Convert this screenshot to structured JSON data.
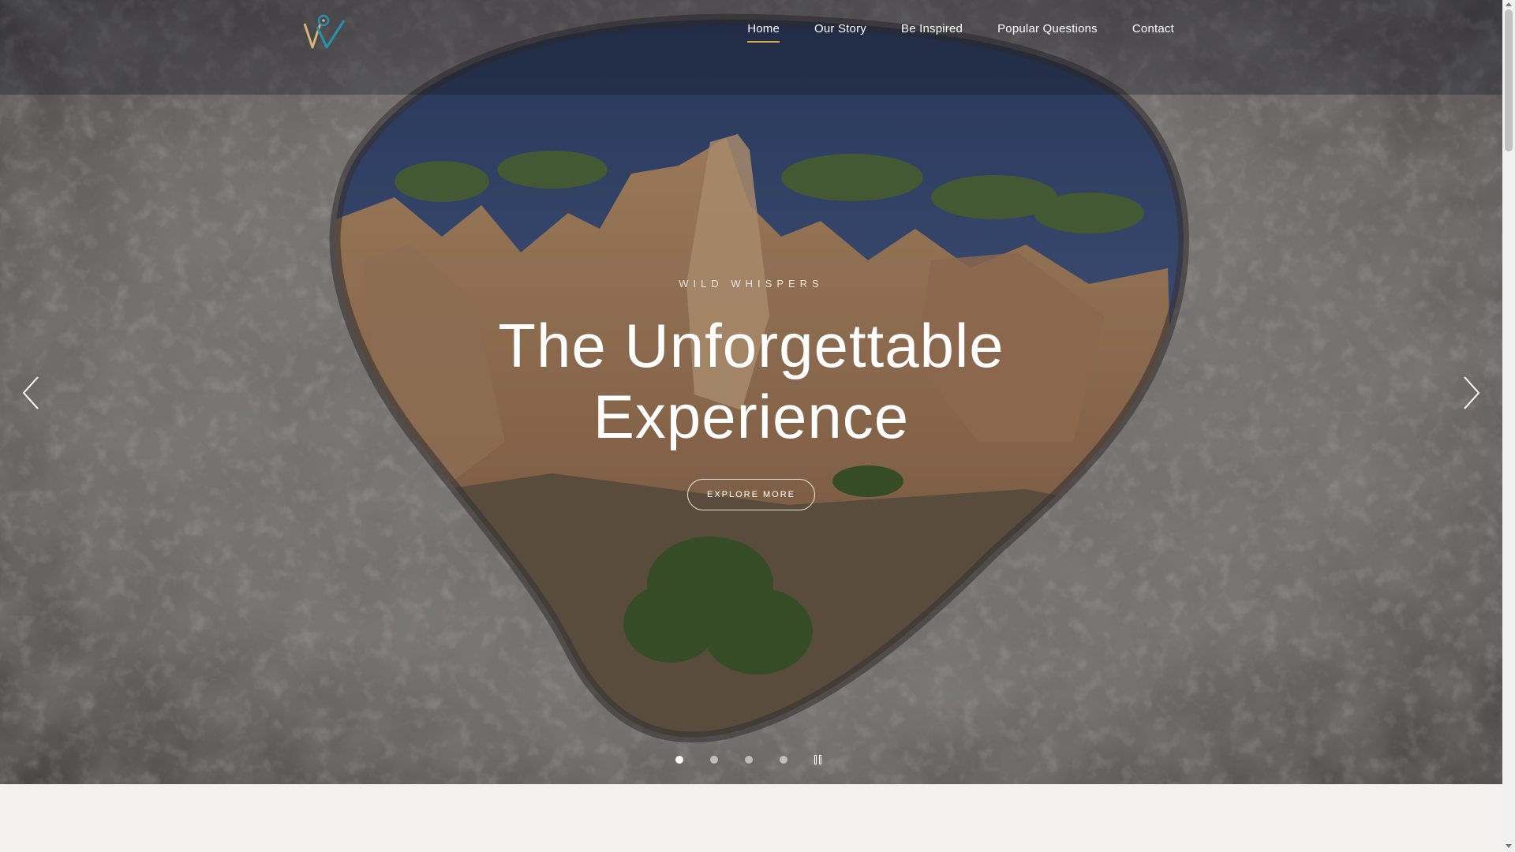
{
  "site": {
    "brand_colors": {
      "accent": "#d9a64c",
      "logo_teal": "#2a8fa8",
      "logo_tan": "#d9b27a",
      "section_bg": "#f4f2ee"
    }
  },
  "nav": {
    "items": [
      {
        "label": "Home",
        "active": true
      },
      {
        "label": "Our Story",
        "active": false
      },
      {
        "label": "Be Inspired",
        "active": false
      },
      {
        "label": "Popular Questions",
        "active": false
      },
      {
        "label": "Contact",
        "active": false
      }
    ]
  },
  "hero": {
    "eyebrow": "WILD WHISPERS",
    "headline": "The Unforgettable Experience",
    "cta_label": "EXPLORE MORE",
    "slides": {
      "count": 4,
      "current": 1
    },
    "icons": {
      "prev": "chevron-left-icon",
      "next": "chevron-right-icon",
      "pause": "pause-icon",
      "logo": "logo-icon"
    }
  }
}
